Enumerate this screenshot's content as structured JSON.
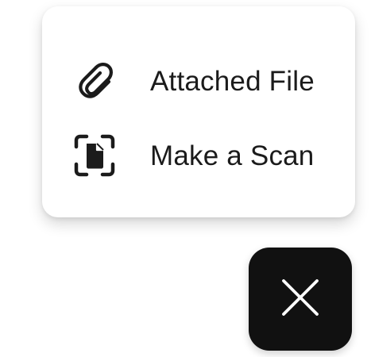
{
  "menu": {
    "items": [
      {
        "label": "Attached File",
        "icon": "paperclip-icon"
      },
      {
        "label": "Make a Scan",
        "icon": "document-scan-icon"
      }
    ]
  },
  "fab": {
    "icon": "close-icon",
    "background": "#111111",
    "icon_color": "#ffffff"
  }
}
